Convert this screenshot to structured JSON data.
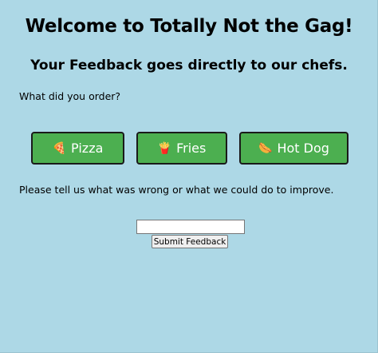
{
  "header": {
    "title": "Welcome to Totally Not the Gag!",
    "subtitle": "Your Feedback goes directly to our chefs."
  },
  "order": {
    "question": "What did you order?",
    "options": [
      {
        "icon": "pizza-icon",
        "emoji": "🍕",
        "label": "Pizza"
      },
      {
        "icon": "fries-icon",
        "emoji": "🍟",
        "label": "Fries"
      },
      {
        "icon": "hotdog-icon",
        "emoji": "🌭",
        "label": "Hot Dog"
      }
    ]
  },
  "feedback": {
    "prompt": "Please tell us what was wrong or what we could do to improve.",
    "input_value": "",
    "submit_label": "Submit Feedback"
  },
  "colors": {
    "background": "#add8e6",
    "button": "#4caf50"
  }
}
